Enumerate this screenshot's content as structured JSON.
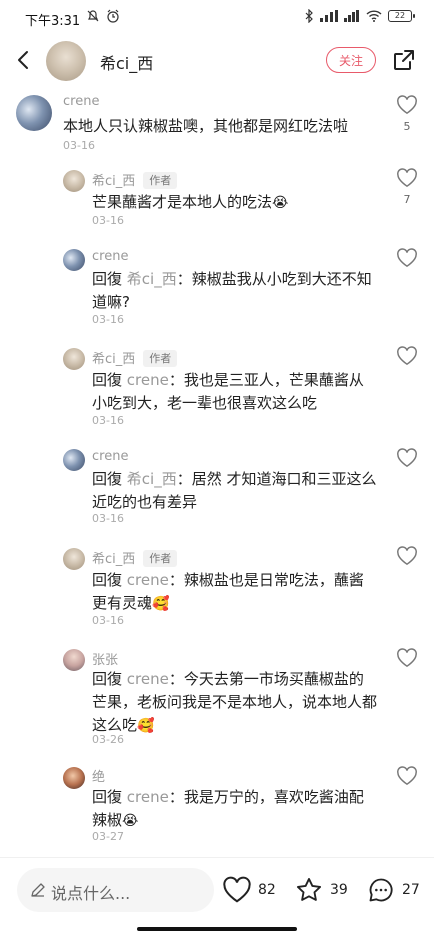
{
  "status_bar": {
    "time": "下午3:31",
    "battery": "22"
  },
  "header": {
    "name": "希ci_西",
    "follow_label": "关注"
  },
  "comments": [
    {
      "user": "crene",
      "badge": "",
      "reply_prefix": "",
      "reply_to": "",
      "text": "本地人只认辣椒盐噢，其他都是网红吃法啦",
      "emoji": "",
      "date": "03-16",
      "likes": "5"
    },
    {
      "user": "希ci_西",
      "badge": "作者",
      "reply_prefix": "",
      "reply_to": "",
      "text": "芒果蘸酱才是本地人的吃法",
      "emoji": "😭",
      "date": "03-16",
      "likes": "7"
    },
    {
      "user": "crene",
      "badge": "",
      "reply_prefix": "回復",
      "reply_to": "希ci_西",
      "text": "辣椒盐我从小吃到大还不知道嘛?",
      "emoji": "",
      "date": "03-16",
      "likes": ""
    },
    {
      "user": "希ci_西",
      "badge": "作者",
      "reply_prefix": "回復",
      "reply_to": "crene",
      "text": "我也是三亚人，芒果蘸酱从小吃到大，老一辈也很喜欢这么吃",
      "emoji": "",
      "date": "03-16",
      "likes": ""
    },
    {
      "user": "crene",
      "badge": "",
      "reply_prefix": "回復",
      "reply_to": "希ci_西",
      "text": "居然 才知道海口和三亚这么近吃的也有差异",
      "emoji": "",
      "date": "03-16",
      "likes": ""
    },
    {
      "user": "希ci_西",
      "badge": "作者",
      "reply_prefix": "回復",
      "reply_to": "crene",
      "text": "辣椒盐也是日常吃法，蘸酱更有灵魂",
      "emoji": "🥰",
      "date": "03-16",
      "likes": ""
    },
    {
      "user": "张张",
      "badge": "",
      "reply_prefix": "回復",
      "reply_to": "crene",
      "text": "今天去第一市场买蘸椒盐的芒果，老板问我是不是本地人，说本地人都这么吃",
      "emoji": "🥰",
      "date": "03-26",
      "likes": ""
    },
    {
      "user": "绝",
      "badge": "",
      "reply_prefix": "回復",
      "reply_to": "crene",
      "text": "我是万宁的，喜欢吃酱油配辣椒",
      "emoji": "😭",
      "date": "03-27",
      "likes": ""
    }
  ],
  "bottom_bar": {
    "placeholder": "说点什么...",
    "likes": "82",
    "stars": "39",
    "comments": "27"
  }
}
